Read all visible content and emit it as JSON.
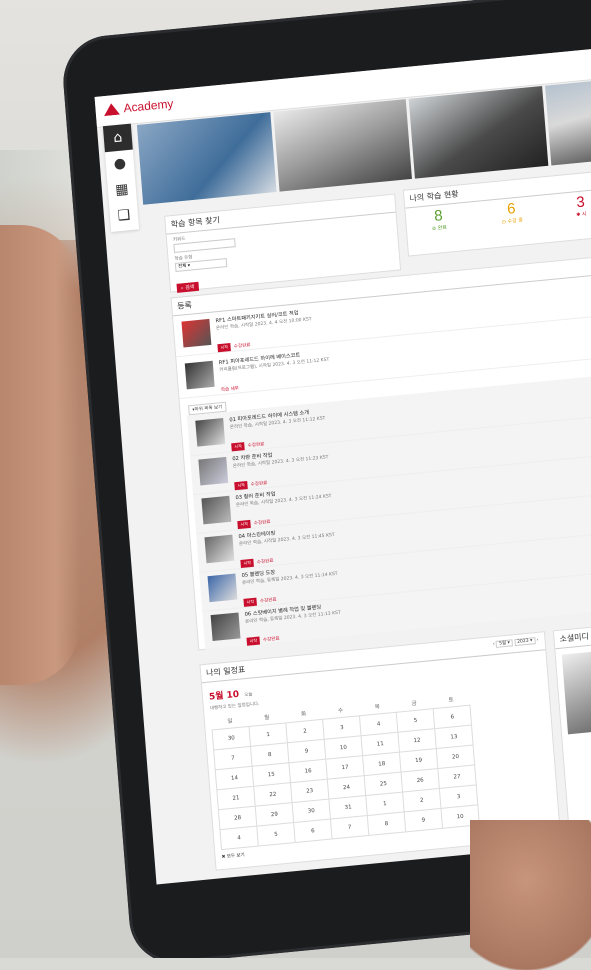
{
  "app": {
    "logo_text": "Academy"
  },
  "sidebar": {
    "items": [
      {
        "icon": "home-icon",
        "glyph": "⌂"
      },
      {
        "icon": "user-icon",
        "glyph": "●"
      },
      {
        "icon": "calendar-icon",
        "glyph": "▦"
      },
      {
        "icon": "book-icon",
        "glyph": "❑"
      }
    ]
  },
  "search": {
    "title": "학습 항목 찾기",
    "keyword_label": "키워드",
    "type_label": "학습 유형",
    "type_value": "전체",
    "search_button": "검색"
  },
  "status": {
    "title": "나의 학습 현황",
    "completed": {
      "value": "8",
      "label": "완료"
    },
    "in_progress": {
      "value": "6",
      "label": "수강 중"
    },
    "required": {
      "value": "3",
      "label": "시"
    }
  },
  "list": {
    "title": "등록",
    "items": [
      {
        "title": "RF1 스마트패키지키트 실러/코트 적업",
        "detail": "온라인 학습, 시작일 2023. 4. 4 오전 10:00 KST",
        "tags": [
          "시작",
          "수강완료"
        ]
      },
      {
        "title": "RF1 피아포레드드 하이메 베이스코트",
        "detail": "커리큘럼(프로그램), 시작일 2023. 4. 3 오전 11:12 KST",
        "tags": [
          "학습 세부"
        ]
      }
    ],
    "subgroup_label": "▾하위 목록 보기",
    "subitems": [
      {
        "title": "01 피아포레드드 하이메 시스템 소개",
        "detail": "온라인 학습, 시작일 2023. 4. 3 오전 11:12 KST",
        "tags": [
          "시작",
          "수강완료"
        ]
      },
      {
        "title": "02 차량 준비 작업",
        "detail": "온라인 학습, 시작일 2023. 4. 3 오전 11:23 KST",
        "tags": [
          "시작",
          "수강완료"
        ]
      },
      {
        "title": "03 컬러 준비 작업",
        "detail": "온라인 학습, 시작일 2023. 4. 3 오전 11:24 KST",
        "tags": [
          "시작",
          "수강완료"
        ]
      },
      {
        "title": "04 마스킹테이핑",
        "detail": "온라인 학습, 시작일 2023. 4. 3 오전 11:45 KST",
        "tags": [
          "시작",
          "수강완료"
        ]
      },
      {
        "title": "05 블렌딩 도장",
        "detail": "온라인 학습, 등록일 2023. 4. 3 오전 11:14 KST",
        "tags": [
          "시작",
          "수강완료"
        ]
      },
      {
        "title": "06 스팟베이지 별례 작업 및 블렌딩",
        "detail": "온라인 학습, 등록일 2023. 4. 3 오전 11:13 KST",
        "tags": [
          "시작",
          "수강완료"
        ]
      }
    ]
  },
  "calendar": {
    "title": "나의 일정표",
    "date_heading": "5월 10",
    "weekday": "오늘",
    "empty_text": "대행하고 있는 일정입니다.",
    "month_select": "5월",
    "year_select": "2023",
    "weekdays": [
      "일",
      "월",
      "화",
      "수",
      "목",
      "금",
      "토"
    ],
    "weeks": [
      [
        "30",
        "1",
        "2",
        "3",
        "4",
        "5",
        "6"
      ],
      [
        "7",
        "8",
        "9",
        "10",
        "11",
        "12",
        "13"
      ],
      [
        "14",
        "15",
        "16",
        "17",
        "18",
        "19",
        "20"
      ],
      [
        "21",
        "22",
        "23",
        "24",
        "25",
        "26",
        "27"
      ],
      [
        "28",
        "29",
        "30",
        "31",
        "1",
        "2",
        "3"
      ],
      [
        "4",
        "5",
        "6",
        "7",
        "8",
        "9",
        "10"
      ]
    ],
    "footer_link": "모두 보기"
  },
  "social": {
    "title": "소셜미디"
  },
  "colors": {
    "accent": "#c8102e",
    "completed": "#5a9e2f",
    "in_progress": "#e6a100",
    "required": "#c8102e"
  }
}
